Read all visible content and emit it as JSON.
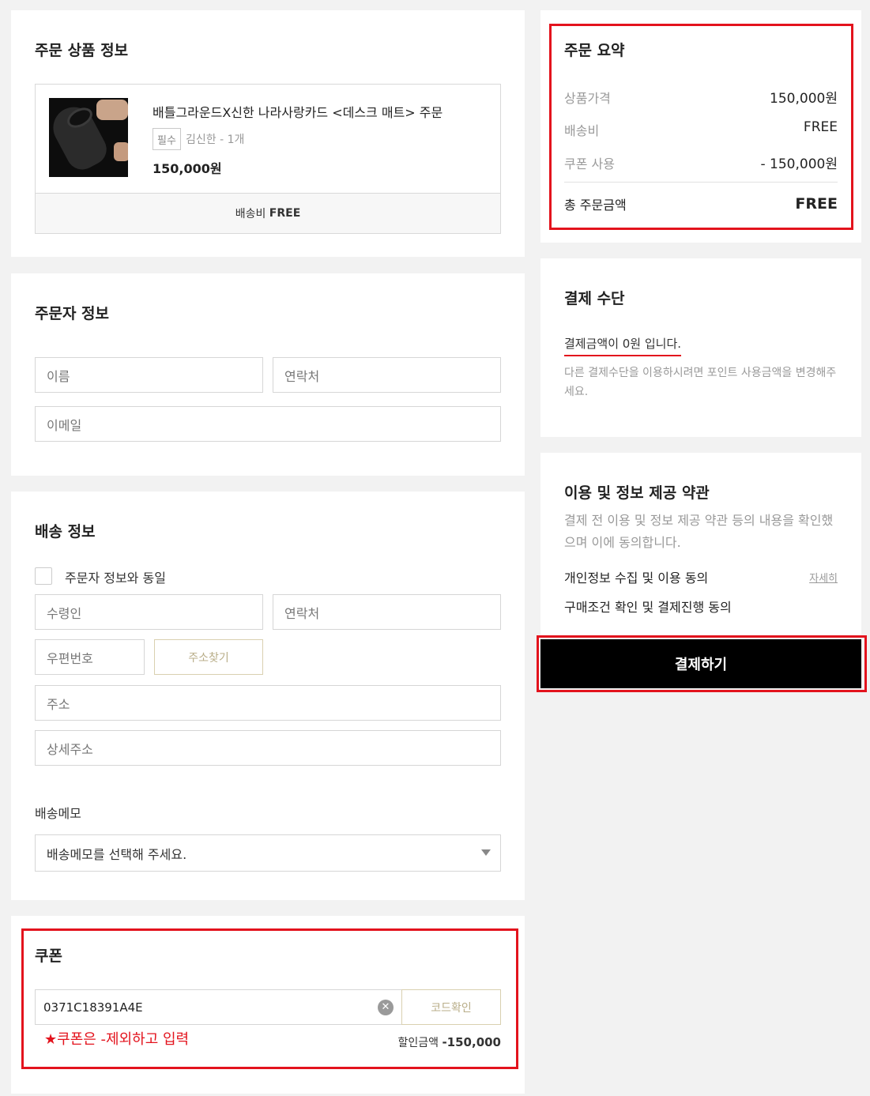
{
  "order_product": {
    "title": "주문 상품 정보",
    "product_name": "배틀그라운드X신한 나라사랑카드 <데스크 매트> 주문",
    "required_badge": "필수",
    "option_text": "김신한 - 1개",
    "price": "150,000원",
    "shipping_label": "배송비",
    "shipping_value": "FREE"
  },
  "orderer": {
    "title": "주문자 정보",
    "name_placeholder": "이름",
    "phone_placeholder": "연락처",
    "email_placeholder": "이메일"
  },
  "shipping": {
    "title": "배송 정보",
    "same_as_orderer": "주문자 정보와 동일",
    "receiver_placeholder": "수령인",
    "phone_placeholder": "연락처",
    "zip_placeholder": "우편번호",
    "find_address_button": "주소찾기",
    "address_placeholder": "주소",
    "detail_address_placeholder": "상세주소",
    "memo_label": "배송메모",
    "memo_select": "배송메모를 선택해 주세요."
  },
  "coupon": {
    "title": "쿠폰",
    "code_value": "0371C18391A4E",
    "confirm_button": "코드확인",
    "note": "★쿠폰은 -제외하고 입력",
    "discount_label": "할인금액",
    "discount_value": "-150,000"
  },
  "summary": {
    "title": "주문 요약",
    "rows": [
      {
        "label": "상품가격",
        "value": "150,000원"
      },
      {
        "label": "배송비",
        "value": "FREE"
      },
      {
        "label": "쿠폰 사용",
        "value": "- 150,000원"
      }
    ],
    "total_label": "총 주문금액",
    "total_value": "FREE"
  },
  "payment": {
    "title": "결제 수단",
    "amount_text": "결제금액이 0원 입니다.",
    "note": "다른 결제수단을 이용하시려면 포인트 사용금액을 변경해주세요."
  },
  "terms": {
    "title": "이용 및 정보 제공 약관",
    "description": "결제 전 이용 및 정보 제공 약관 등의 내용을 확인했으며 이에 동의합니다.",
    "privacy_agree": "개인정보 수집 및 이용 동의",
    "detail_link": "자세히",
    "purchase_agree": "구매조건 확인 및 결제진행 동의",
    "pay_button": "결제하기"
  },
  "colors": {
    "accent_red": "#e3131d",
    "button_black": "#000000",
    "page_bg": "#f2f2f2",
    "gold_border": "#d9d0b0"
  }
}
